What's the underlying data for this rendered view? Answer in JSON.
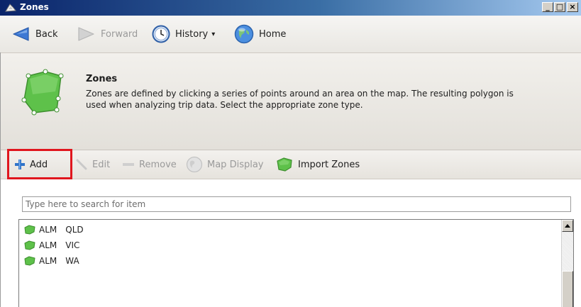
{
  "window": {
    "title": "Zones",
    "minimize_glyph": "_",
    "maximize_glyph": "□",
    "close_glyph": "×"
  },
  "nav": {
    "back_label": "Back",
    "forward_label": "Forward",
    "history_label": "History",
    "history_caret": "▾",
    "home_label": "Home"
  },
  "header": {
    "title": "Zones",
    "description": "Zones are defined by clicking a series of points around an area on the map. The resulting polygon is used when analyzing trip data. Select the appropriate zone type."
  },
  "toolbar": {
    "add_label": "Add",
    "edit_label": "Edit",
    "remove_label": "Remove",
    "map_display_label": "Map Display",
    "import_label": "Import Zones"
  },
  "search": {
    "placeholder": "Type here to search for item",
    "value": ""
  },
  "zones": [
    {
      "code": "ALM",
      "region": "QLD"
    },
    {
      "code": "ALM",
      "region": "VIC"
    },
    {
      "code": "ALM",
      "region": "WA"
    }
  ],
  "colors": {
    "zone_green": "#5ec14a",
    "highlight_red": "#e0161e",
    "back_blue": "#3d78d4",
    "add_blue": "#2f73c9"
  },
  "icons": {
    "app": "zones-app-icon",
    "back": "back-arrow-icon",
    "forward": "forward-arrow-icon",
    "history": "clock-icon",
    "home": "globe-icon",
    "header": "polygon-zone-icon",
    "add": "plus-icon",
    "edit": "pencil-icon",
    "remove": "minus-icon",
    "map_display": "globe-icon",
    "import": "zone-import-icon",
    "list_item": "zone-polygon-icon"
  }
}
